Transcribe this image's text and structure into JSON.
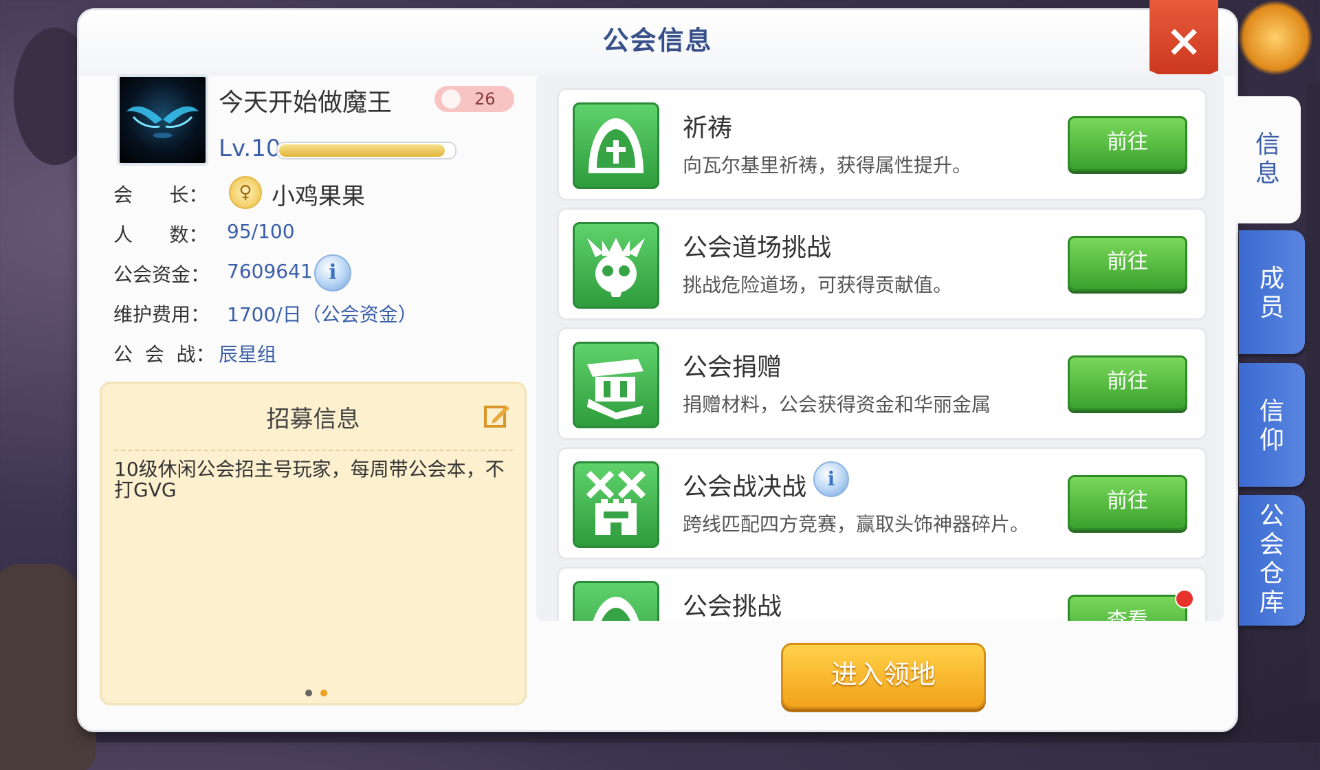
{
  "dialog": {
    "title": "公会信息",
    "close_label": "×"
  },
  "guild": {
    "name": "今天开始做魔王",
    "rank": "26",
    "level": "Lv.10",
    "level_progress": 0.95
  },
  "info": {
    "leader_label": "会      长：",
    "leader_icon": "♀",
    "leader_value": "小鸡果果",
    "members_label": "人      数：",
    "members_value": "95/100",
    "funds_label": "公会资金：",
    "funds_value": "7609641",
    "info_icon": "i",
    "upkeep_label": "维护费用：",
    "upkeep_value": "1700/日（公会资金）",
    "war_label": "公  会  战：",
    "war_value": "辰星组"
  },
  "recruit": {
    "title": "招募信息",
    "text": "10级休闲公会招主号玩家，每周带公会本，不打GVG"
  },
  "activities": [
    {
      "title": "祈祷",
      "desc": "向瓦尔基里祈祷，获得属性提升。",
      "button": "前往",
      "icon": "prayer-icon"
    },
    {
      "title": "公会道场挑战",
      "desc": "挑战危险道场，可获得贡献值。",
      "button": "前往",
      "icon": "demon-skull-icon"
    },
    {
      "title": "公会捐赠",
      "desc": "捐赠材料，公会获得资金和华丽金属",
      "button": "前往",
      "icon": "donation-icon"
    },
    {
      "title": "公会战决战",
      "desc": "跨线匹配四方竞赛，赢取头饰神器碎片。",
      "button": "前往",
      "icon": "castle-swords-icon",
      "info_icon": "i"
    },
    {
      "title": "公会挑战",
      "desc": "",
      "button": "查看",
      "icon": "prayer-icon"
    }
  ],
  "enter_territory": "进入领地",
  "side_tabs": [
    {
      "label_line1": "信",
      "label_line2": "息"
    },
    {
      "label_line1": "成",
      "label_line2": "员"
    },
    {
      "label_line1": "信",
      "label_line2": "仰"
    },
    {
      "label_line1": "公",
      "label_line2": "会",
      "label_line3": "仓",
      "label_line4": "库"
    }
  ],
  "colors": {
    "accent_blue": "#3a5ea8",
    "button_green": "#3aa22e",
    "button_orange": "#f2a21a",
    "close_red": "#c8331c"
  }
}
